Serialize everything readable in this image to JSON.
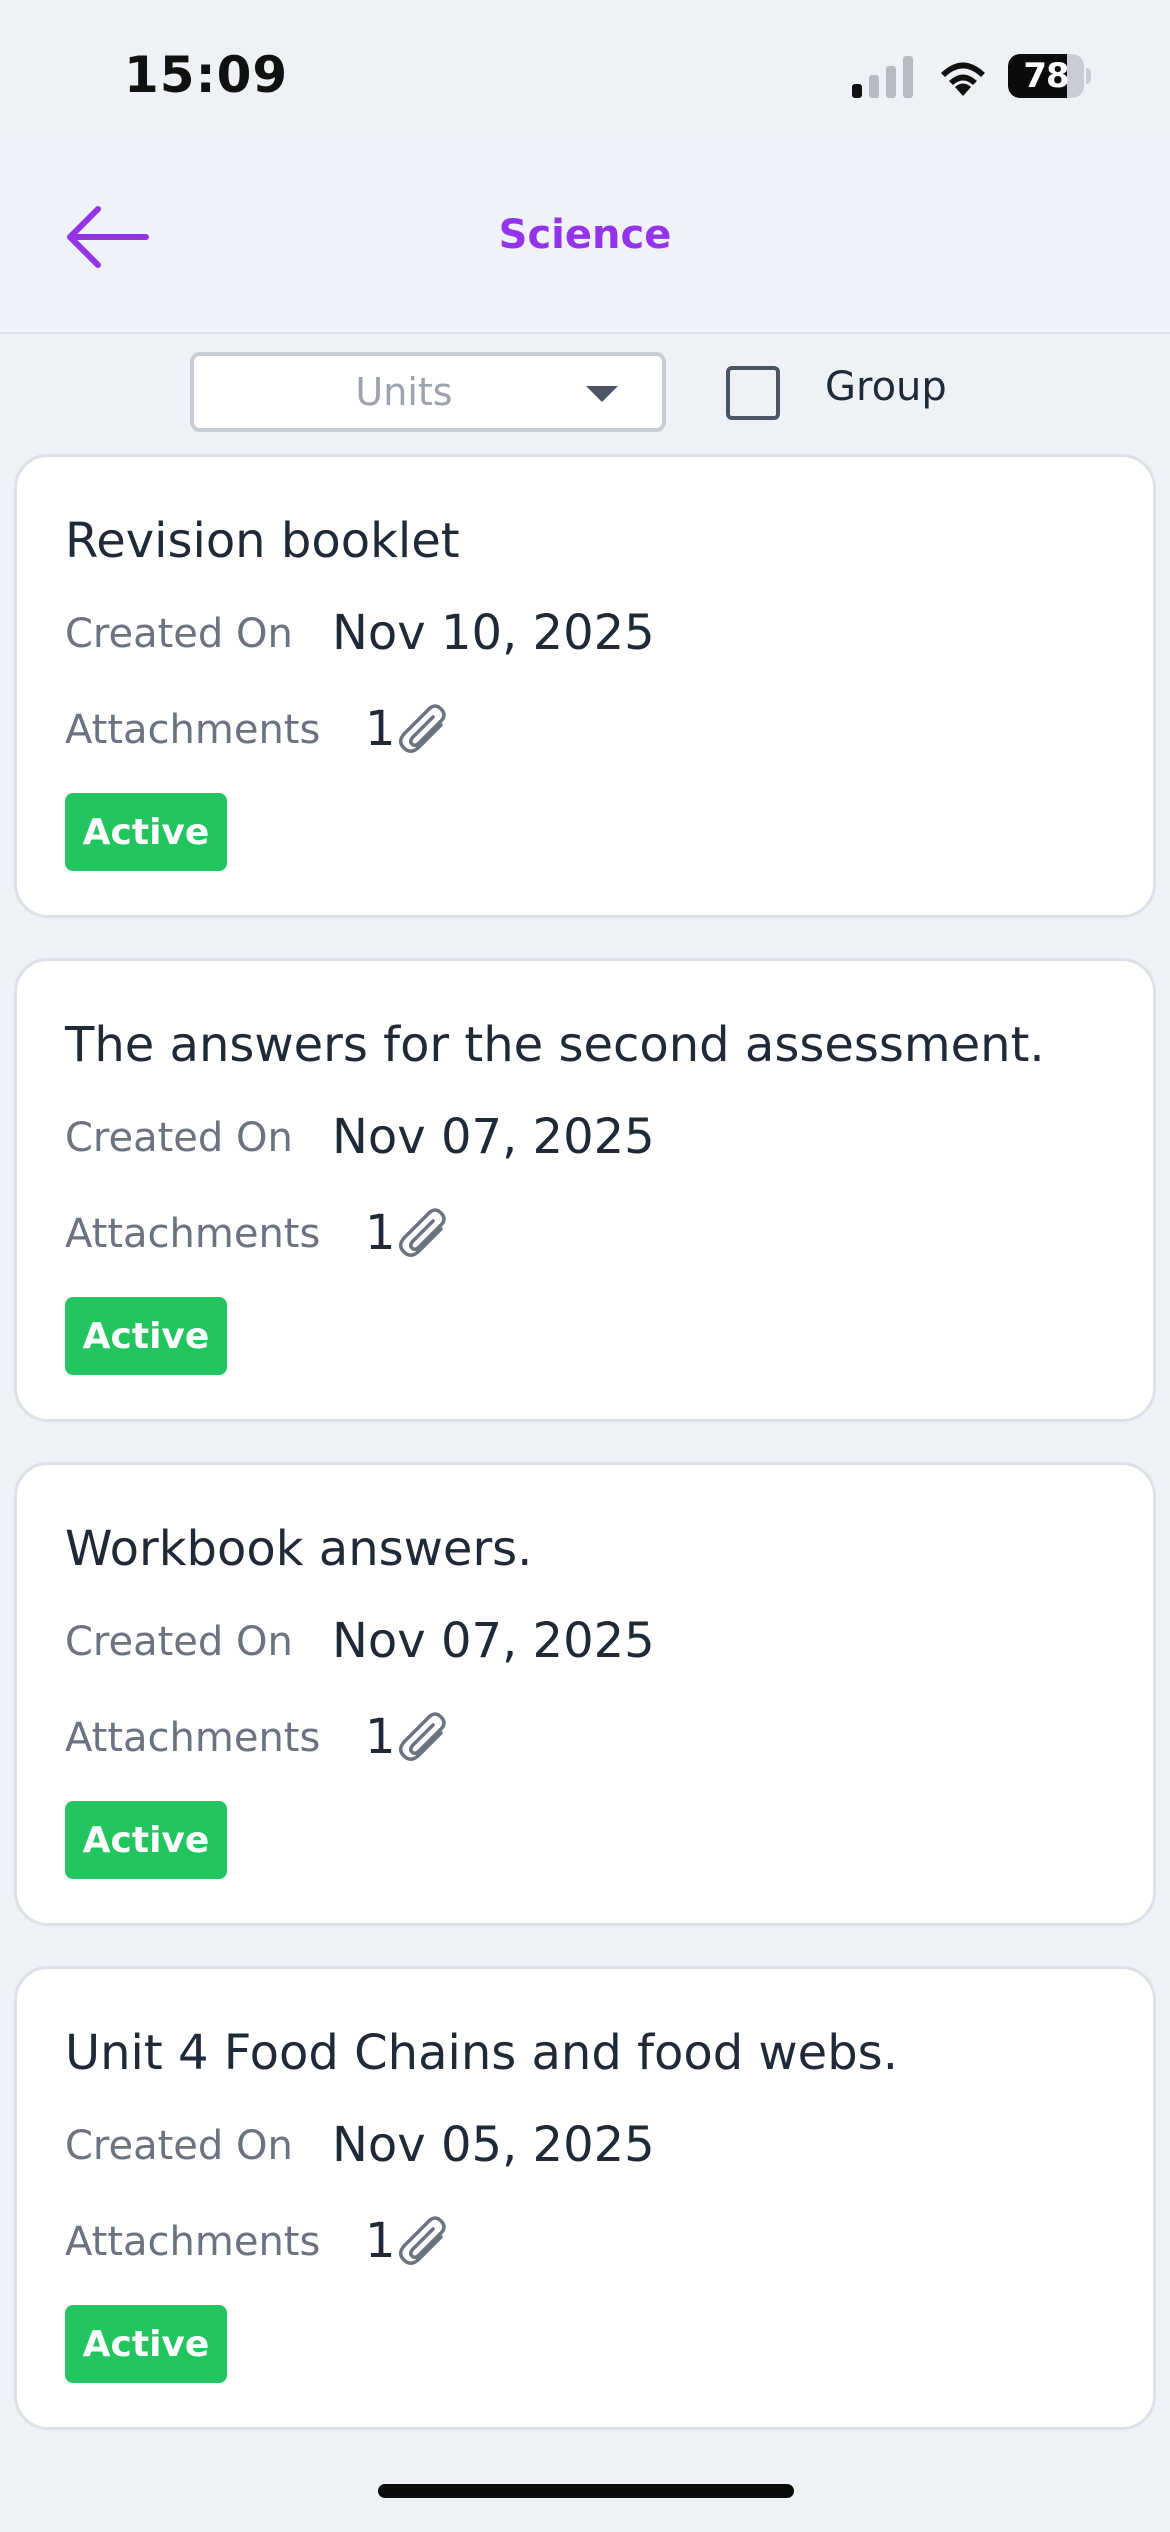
{
  "status_bar": {
    "time": "15:09",
    "battery_level": "78",
    "battery_fraction": 0.78
  },
  "header": {
    "title": "Science",
    "back_icon": "arrow-left-icon",
    "accent_color": "#9333ea"
  },
  "filters": {
    "units_placeholder": "Units",
    "group_label": "Group",
    "group_checked": false
  },
  "labels": {
    "created_on": "Created On",
    "attachments": "Attachments"
  },
  "cards": [
    {
      "title": "Revision booklet",
      "created_on": "Nov 10, 2025",
      "attachments": "1",
      "status": "Active"
    },
    {
      "title": "The answers for the second assessment.",
      "created_on": "Nov 07, 2025",
      "attachments": "1",
      "status": "Active"
    },
    {
      "title": "Workbook answers.",
      "created_on": "Nov 07, 2025",
      "attachments": "1",
      "status": "Active"
    },
    {
      "title": "Unit 4 Food Chains and food webs.",
      "created_on": "Nov 05, 2025",
      "attachments": "1",
      "status": "Active"
    }
  ],
  "colors": {
    "status_active": "#22c55e",
    "background": "#eef1f6"
  }
}
